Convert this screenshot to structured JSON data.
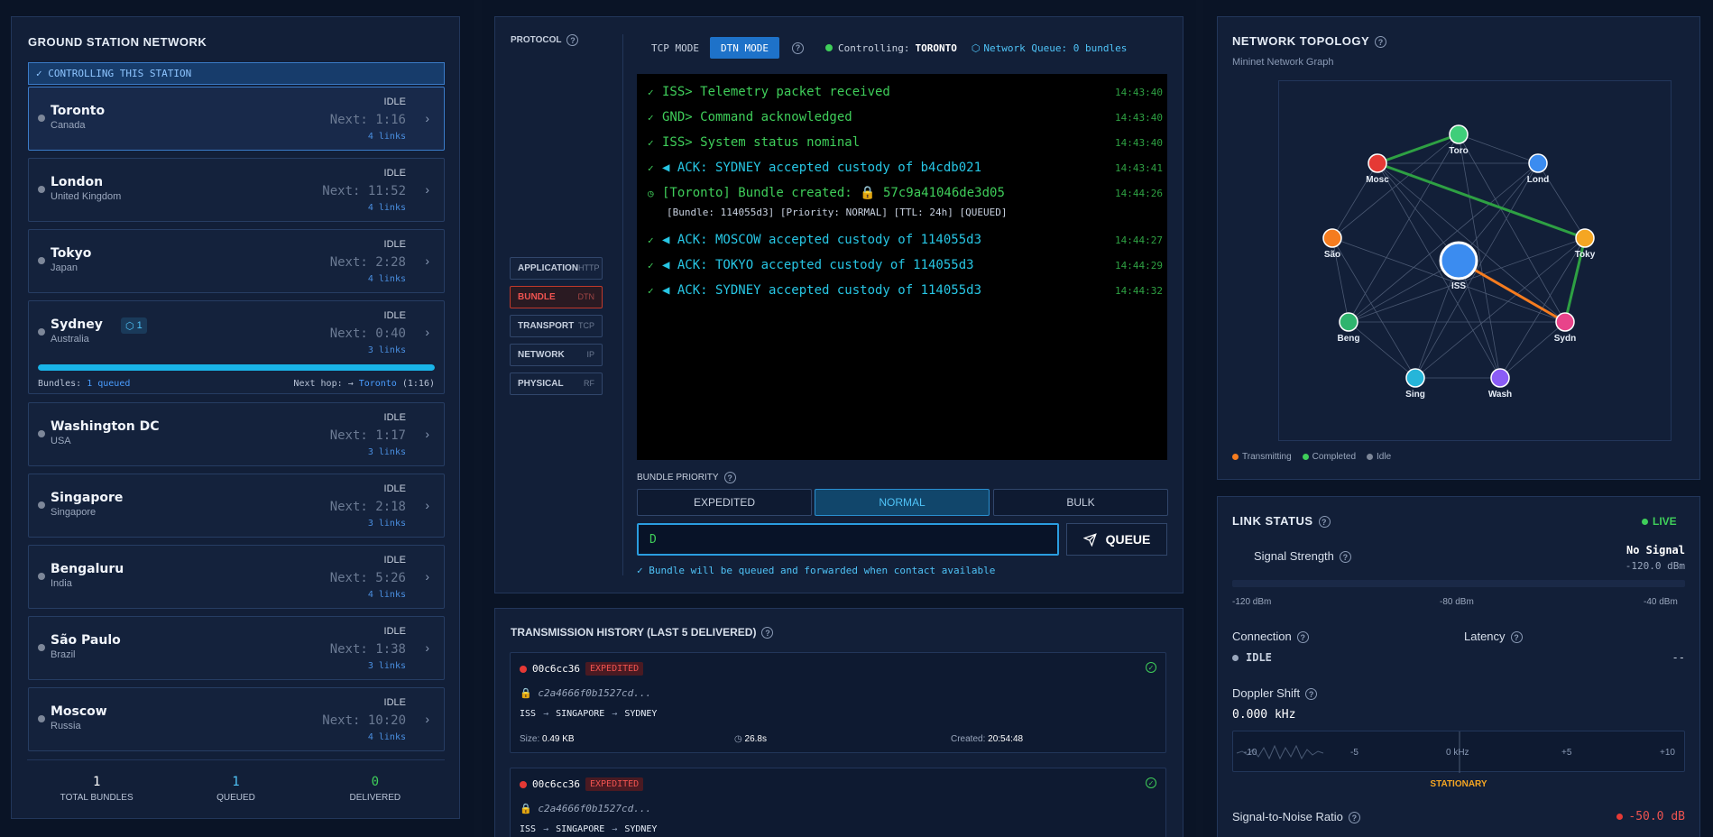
{
  "left": {
    "title": "GROUND STATION NETWORK",
    "controlling_banner": "✓ CONTROLLING THIS STATION",
    "stations": [
      {
        "name": "Toronto",
        "country": "Canada",
        "state": "IDLE",
        "next": "Next: 1:16",
        "links": "4 links"
      },
      {
        "name": "London",
        "country": "United Kingdom",
        "state": "IDLE",
        "next": "Next: 11:52",
        "links": "4 links"
      },
      {
        "name": "Tokyo",
        "country": "Japan",
        "state": "IDLE",
        "next": "Next: 2:28",
        "links": "4 links"
      },
      {
        "name": "Sydney",
        "country": "Australia",
        "state": "IDLE",
        "next": "Next: 0:40",
        "links": "3 links",
        "badge": "1",
        "progress": 1.0,
        "bundles_label": "Bundles:",
        "bundles_value": "1 queued",
        "nexthop_label": "Next hop: →",
        "nexthop_value": "Toronto",
        "nexthop_time": "(1:16)"
      },
      {
        "name": "Washington DC",
        "country": "USA",
        "state": "IDLE",
        "next": "Next: 1:17",
        "links": "3 links"
      },
      {
        "name": "Singapore",
        "country": "Singapore",
        "state": "IDLE",
        "next": "Next: 2:18",
        "links": "3 links"
      },
      {
        "name": "Bengaluru",
        "country": "India",
        "state": "IDLE",
        "next": "Next: 5:26",
        "links": "4 links"
      },
      {
        "name": "São Paulo",
        "country": "Brazil",
        "state": "IDLE",
        "next": "Next: 1:38",
        "links": "3 links"
      },
      {
        "name": "Moscow",
        "country": "Russia",
        "state": "IDLE",
        "next": "Next: 10:20",
        "links": "4 links"
      }
    ],
    "stats": [
      {
        "value": "1",
        "label": "TOTAL BUNDLES",
        "color": "#ffffff"
      },
      {
        "value": "1",
        "label": "QUEUED",
        "color": "#4fc3f7"
      },
      {
        "value": "0",
        "label": "DELIVERED",
        "color": "#3fce5a"
      }
    ]
  },
  "protocol": {
    "title": "PROTOCOL",
    "layers": [
      {
        "name": "APPLICATION",
        "tag": "HTTP",
        "active": false
      },
      {
        "name": "BUNDLE",
        "tag": "DTN",
        "active": true
      },
      {
        "name": "TRANSPORT",
        "tag": "TCP",
        "active": false
      },
      {
        "name": "NETWORK",
        "tag": "IP",
        "active": false
      },
      {
        "name": "PHYSICAL",
        "tag": "RF",
        "active": false
      }
    ],
    "tcp_mode": "TCP MODE",
    "dtn_mode": "DTN MODE",
    "controlling_label": "Controlling:",
    "controlling_value": "TORONTO",
    "network_queue": "Network Queue: 0 bundles"
  },
  "console": {
    "lines": [
      {
        "icon": "✓",
        "text": "ISS> Telemetry packet received",
        "ts": "14:43:40",
        "color": "green"
      },
      {
        "icon": "✓",
        "text": "GND> Command acknowledged",
        "ts": "14:43:40",
        "color": "green"
      },
      {
        "icon": "✓",
        "text": "ISS> System status nominal",
        "ts": "14:43:40",
        "color": "green"
      },
      {
        "icon": "✓",
        "text": "◀ ACK: SYDNEY accepted custody of b4cdb021",
        "ts": "14:43:41",
        "color": "cyan"
      },
      {
        "icon": "◷",
        "text": "[Toronto] Bundle created: 🔒 57c9a41046de3d05",
        "ts": "14:44:26",
        "color": "green"
      },
      {
        "icon": "✓",
        "text": "◀ ACK: MOSCOW accepted custody of 114055d3",
        "ts": "14:44:27",
        "color": "cyan"
      },
      {
        "icon": "✓",
        "text": "◀ ACK: TOKYO accepted custody of 114055d3",
        "ts": "14:44:29",
        "color": "cyan"
      },
      {
        "icon": "✓",
        "text": "◀ ACK: SYDNEY accepted custody of 114055d3",
        "ts": "14:44:32",
        "color": "cyan"
      }
    ],
    "subline": "[Bundle: 114055d3] [Priority: NORMAL] [TTL: 24h] [QUEUED]"
  },
  "bundle_priority": {
    "label": "BUNDLE PRIORITY",
    "options": [
      "EXPEDITED",
      "NORMAL",
      "BULK"
    ],
    "selected": "NORMAL",
    "input_value": "D",
    "queue_button": "QUEUE",
    "hint": "✓ Bundle will be queued and forwarded when contact available"
  },
  "history": {
    "title": "TRANSMISSION HISTORY (LAST 5 DELIVERED)",
    "items": [
      {
        "id": "00c6cc36",
        "priority": "EXPEDITED",
        "hash": "c2a4666f0b1527cd...",
        "route": [
          "ISS",
          "SINGAPORE",
          "SYDNEY"
        ],
        "size_label": "Size:",
        "size": "0.49 KB",
        "duration": "26.8s",
        "created_label": "Created:",
        "created": "20:54:48"
      },
      {
        "id": "00c6cc36",
        "priority": "EXPEDITED",
        "hash": "c2a4666f0b1527cd...",
        "route": [
          "ISS",
          "SINGAPORE",
          "SYDNEY"
        ]
      }
    ]
  },
  "topology": {
    "title": "NETWORK TOPOLOGY",
    "subtitle": "Mininet Network Graph",
    "nodes": [
      {
        "id": "Toro",
        "color": "#3fce7a"
      },
      {
        "id": "Lond",
        "color": "#3b8cf0"
      },
      {
        "id": "Mosc",
        "color": "#e53935"
      },
      {
        "id": "Toky",
        "color": "#f5a623"
      },
      {
        "id": "São",
        "color": "#f57c1f"
      },
      {
        "id": "ISS",
        "color": "#3b8cf0"
      },
      {
        "id": "Beng",
        "color": "#2fb46e"
      },
      {
        "id": "Sydn",
        "color": "#e8448a"
      },
      {
        "id": "Sing",
        "color": "#26b5d9"
      },
      {
        "id": "Wash",
        "color": "#8b5cf6"
      }
    ],
    "legend": [
      {
        "label": "Transmitting",
        "color": "#f57c1f"
      },
      {
        "label": "Completed",
        "color": "#3fce5a"
      },
      {
        "label": "Idle",
        "color": "#7d8799"
      }
    ]
  },
  "link_status": {
    "title": "LINK STATUS",
    "live": "LIVE",
    "signal_label": "Signal Strength",
    "signal_value": "No Signal",
    "signal_dbm": "-120.0 dBm",
    "scale": [
      "-120 dBm",
      "-80 dBm",
      "-40 dBm"
    ],
    "connection_label": "Connection",
    "connection_value": "IDLE",
    "latency_label": "Latency",
    "latency_value": "--",
    "doppler_label": "Doppler Shift",
    "doppler_value": "0.000 kHz",
    "doppler_scale": [
      "-10",
      "-5",
      "0 kHz",
      "+5",
      "+10"
    ],
    "doppler_state": "STATIONARY",
    "snr_label": "Signal-to-Noise Ratio",
    "snr_value": "-50.0 dB"
  }
}
